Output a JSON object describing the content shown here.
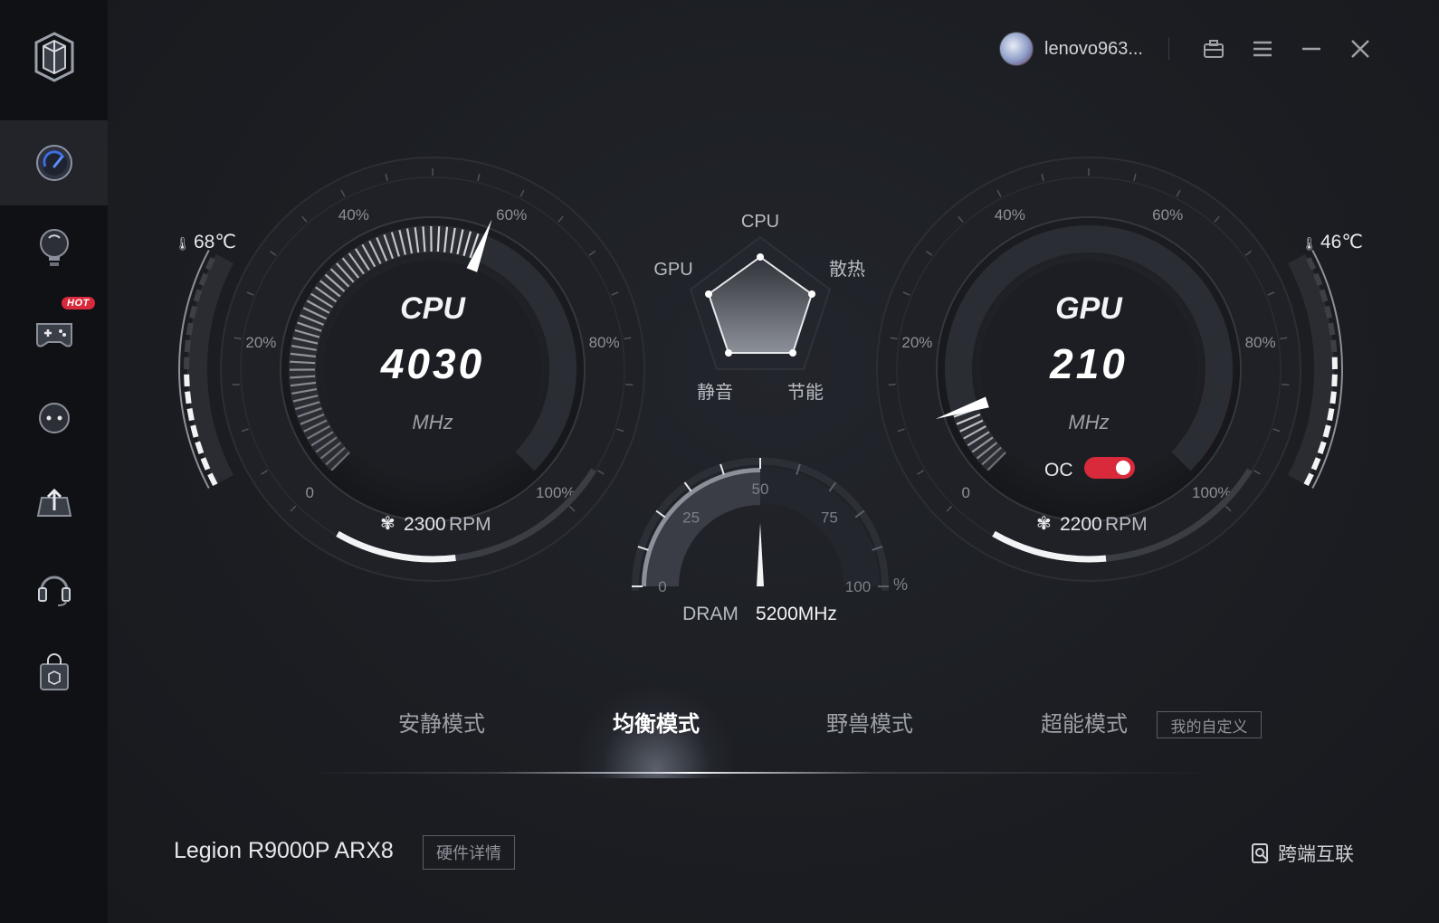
{
  "user": {
    "name": "lenovo963..."
  },
  "sidebar": {
    "items": [
      {
        "name": "performance",
        "active": true
      },
      {
        "name": "lighting"
      },
      {
        "name": "games",
        "badge": "HOT"
      },
      {
        "name": "chat"
      },
      {
        "name": "upload"
      },
      {
        "name": "headset"
      },
      {
        "name": "store"
      }
    ]
  },
  "cpu": {
    "label": "CPU",
    "value": "4030",
    "unit": "MHz",
    "temp": "68℃",
    "fan": "2300",
    "fan_unit": "RPM",
    "load_percent": 58,
    "temp_level": 0.45,
    "fan_level": 0.42
  },
  "gpu": {
    "label": "GPU",
    "value": "210",
    "unit": "MHz",
    "temp": "46℃",
    "fan": "2200",
    "fan_unit": "RPM",
    "load_percent": 10,
    "temp_level": 0.55,
    "fan_level": 0.4,
    "oc_label": "OC",
    "oc_enabled": true
  },
  "gauge_ticks": [
    "0",
    "20%",
    "40%",
    "60%",
    "80%",
    "100%"
  ],
  "radar": {
    "labels": {
      "top": "CPU",
      "left": "GPU",
      "right": "散热",
      "bottom_left": "静音",
      "bottom_right": "节能"
    }
  },
  "dram": {
    "label": "DRAM",
    "value": "5200MHz",
    "percent": 50,
    "ticks": [
      "0",
      "25",
      "50",
      "75",
      "100"
    ],
    "unit": "%"
  },
  "modes": {
    "quiet": "安静模式",
    "balanced": "均衡模式",
    "beast": "野兽模式",
    "super": "超能模式",
    "custom": "我的自定义",
    "active": "balanced"
  },
  "footer": {
    "device": "Legion R9000P ARX8",
    "hw_details": "硬件详情",
    "cross_link": "跨端互联"
  },
  "colors": {
    "accent_red": "#d82a3b",
    "text": "#d8dadf",
    "bg": "#1b1d22"
  }
}
